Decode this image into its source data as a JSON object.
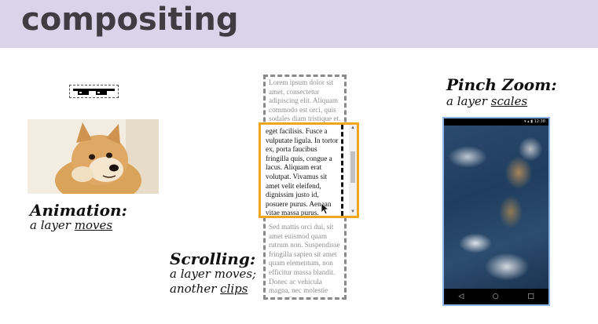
{
  "header": {
    "title": "compositing",
    "background": "#dad4ea"
  },
  "animation": {
    "title": "Animation:",
    "subtitle_prefix": "a layer ",
    "subtitle_underlined": "moves"
  },
  "scrolling": {
    "title": "Scrolling:",
    "subtitle_line1": "a layer moves;",
    "subtitle_line2_prefix": "another ",
    "subtitle_line2_underlined": "clips",
    "outer_text_top": "Lorem ipsum dolor sit amet, consectetur adipiscing elit. Aliquam commodo est orci, quis sodales diam tristique et. Fusce fringilla ac libero",
    "inner_text": "eget facilisis. Fusce a vulputate ligula. In tortor ex, porta faucibus fringilla quis, congue a lacus. Aliquam erat volutpat. Vivamus sit amet velit eleifend, dignissim justo id, posuere purus. Aenean vitae massa purus. Aliquam erat volutpat.",
    "outer_text_bottom": "Sed mattis orci dui, sit amet euismod quam rutrum non. Suspendisse fringilla sapien sit amet quam elementum, non efficitur massa blandit. Donec ac vehicula magna, nec molestie tortor. Fusce ultricies at justo non hendrerit.",
    "frame_color": "#f2a51f"
  },
  "pinch_zoom": {
    "title": "Pinch Zoom:",
    "subtitle_prefix": "a layer ",
    "subtitle_underlined": "scales",
    "status_time": "12:38",
    "phone_border_color": "#8fb6e6"
  }
}
